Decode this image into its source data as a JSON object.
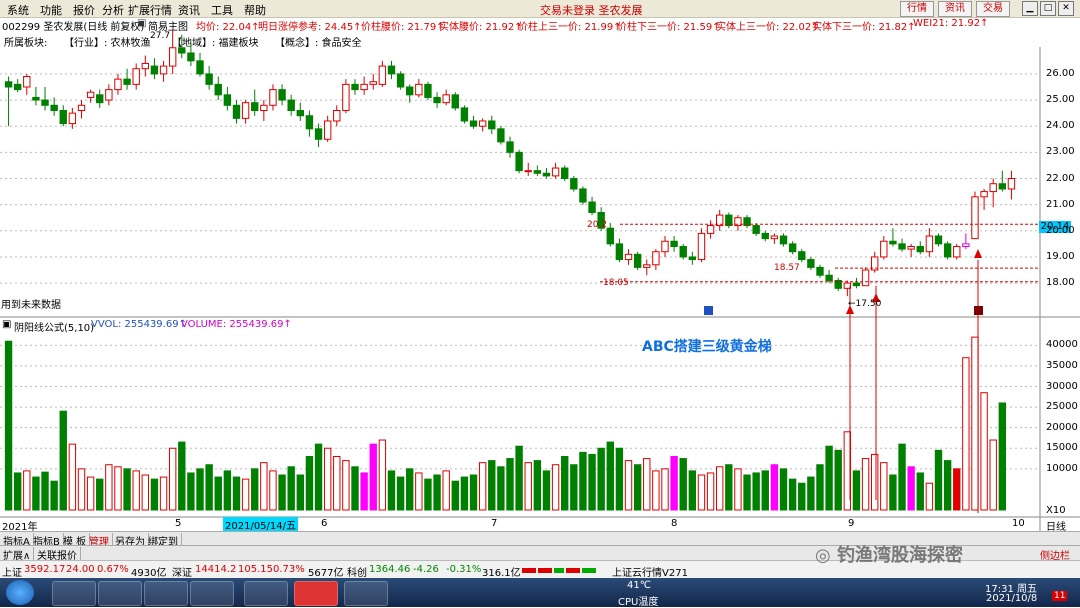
{
  "menu": [
    "系统",
    "功能",
    "报价",
    "分析",
    "扩展行情",
    "资讯",
    "工具",
    "帮助"
  ],
  "title_center": "交易未登录  圣农发展",
  "top_buttons": [
    "行情",
    "资讯",
    "交易"
  ],
  "info": {
    "stock": "002299 圣农发展(日线 前复权)",
    "icon_label": "简易主图",
    "items": [
      "均价: 22.04↑",
      "明日涨停参考: 24.45↑",
      "价柱腰价: 21.79↑",
      "实体腰价: 21.92↑",
      "价柱上三一价: 21.99↑",
      "价柱下三一价: 21.59↑",
      "实体上三一价: 22.02↑",
      "实体下三一价: 21.82↑",
      "WEI21: 21.92↑"
    ]
  },
  "sectors": {
    "label": "所属板块:",
    "industry": "【行业】: 农林牧渔",
    "region": "【地域】: 福建板块",
    "concept": "【概念】: 食品安全",
    "overlay_price": "27.7"
  },
  "price_axis": [
    "26.00",
    "25.00",
    "24.00",
    "23.00",
    "22.00",
    "21.00",
    "20.00",
    "19.00",
    "18.00"
  ],
  "price_current": "20.14",
  "annotations": {
    "left_level": "20.2",
    "mid_level": "18.57",
    "low_level": "18.05",
    "low_point": "17.50",
    "future_data": "用到未来数据",
    "headline": "ABC搭建三级黄金梯"
  },
  "indicator": {
    "name": "阴阳线公式(5,10)",
    "vol": "VVOL: 255439.69↑",
    "volume": "VOLUME: 255439.69↑"
  },
  "volume_axis": [
    "40000",
    "35000",
    "30000",
    "25000",
    "20000",
    "15000",
    "10000",
    "X10"
  ],
  "date_axis": {
    "year": "2021年",
    "months": [
      "5",
      "6",
      "7",
      "8",
      "9",
      "10"
    ],
    "cursor": "2021/05/14/五",
    "period": "日线"
  },
  "bottom_tabs": [
    "指标A",
    "指标B",
    "模 板",
    "管理",
    "另存为",
    "绑定到"
  ],
  "bottom_tabs2": [
    "扩展∧",
    "关联报价"
  ],
  "stats": {
    "sh": "上证",
    "sh_val": "3592.17",
    "sh_chg": "24.00",
    "sh_pct": "0.67%",
    "sh_amt": "4930亿",
    "sz": "深证",
    "sz_val": "14414.2",
    "sz_chg": "105.15",
    "sz_pct": "0.73%",
    "sz_amt": "5677亿",
    "kc": "科创",
    "kc_val": "1364.46",
    "kc_chg": "-4.26",
    "kc_pct": "-0.31%",
    "kc_amt": "316.1亿",
    "cloud": "上证云行情V271"
  },
  "taskbar": {
    "temp": "41℃",
    "cpu": "CPU温度",
    "time": "17:31 周五",
    "date": "2021/10/8",
    "notif": "11"
  },
  "watermark": "钓渔湾股海探密",
  "side_label": "侧边栏",
  "chart_data": {
    "type": "candlestick",
    "y_range": [
      17.2,
      26.8
    ],
    "volume_range": [
      0,
      43000
    ],
    "candles": [
      [
        25.7,
        25.9,
        24.0,
        25.5
      ],
      [
        25.6,
        25.8,
        25.3,
        25.4
      ],
      [
        25.5,
        26.0,
        25.2,
        25.9
      ],
      [
        25.1,
        25.5,
        24.8,
        25.0
      ],
      [
        25.0,
        25.5,
        24.6,
        24.8
      ],
      [
        24.8,
        25.1,
        24.4,
        24.6
      ],
      [
        24.6,
        24.8,
        24.0,
        24.1
      ],
      [
        24.1,
        24.7,
        23.9,
        24.5
      ],
      [
        24.6,
        25.0,
        24.3,
        24.8
      ],
      [
        25.1,
        25.4,
        24.9,
        25.3
      ],
      [
        25.2,
        25.4,
        24.7,
        24.9
      ],
      [
        25.0,
        25.6,
        24.8,
        25.4
      ],
      [
        25.4,
        26.0,
        25.2,
        25.8
      ],
      [
        25.8,
        26.2,
        25.4,
        25.6
      ],
      [
        25.6,
        26.4,
        25.4,
        26.2
      ],
      [
        26.2,
        26.7,
        25.9,
        26.4
      ],
      [
        26.3,
        26.6,
        25.8,
        26.0
      ],
      [
        26.0,
        26.5,
        25.7,
        26.3
      ],
      [
        26.3,
        27.7,
        26.0,
        27.0
      ],
      [
        27.0,
        27.5,
        26.6,
        26.8
      ],
      [
        26.8,
        27.2,
        26.3,
        26.5
      ],
      [
        26.5,
        26.8,
        25.9,
        26.0
      ],
      [
        26.0,
        26.3,
        25.4,
        25.6
      ],
      [
        25.6,
        25.9,
        25.0,
        25.2
      ],
      [
        25.2,
        25.5,
        24.6,
        24.8
      ],
      [
        24.8,
        25.0,
        24.1,
        24.3
      ],
      [
        24.3,
        25.0,
        24.1,
        24.9
      ],
      [
        24.9,
        25.4,
        24.4,
        24.6
      ],
      [
        24.6,
        25.0,
        24.2,
        24.8
      ],
      [
        24.8,
        25.6,
        24.6,
        25.4
      ],
      [
        25.4,
        25.6,
        24.8,
        25.0
      ],
      [
        25.0,
        25.2,
        24.4,
        24.6
      ],
      [
        24.6,
        24.9,
        24.2,
        24.4
      ],
      [
        24.4,
        24.6,
        23.6,
        23.9
      ],
      [
        23.9,
        24.1,
        23.2,
        23.5
      ],
      [
        23.5,
        24.4,
        23.4,
        24.2
      ],
      [
        24.2,
        24.8,
        24.0,
        24.6
      ],
      [
        24.6,
        25.8,
        24.5,
        25.6
      ],
      [
        25.6,
        25.8,
        25.2,
        25.4
      ],
      [
        25.4,
        25.9,
        25.2,
        25.6
      ],
      [
        25.6,
        26.0,
        25.4,
        25.7
      ],
      [
        25.6,
        26.5,
        25.5,
        26.3
      ],
      [
        26.3,
        26.5,
        25.8,
        26.0
      ],
      [
        26.0,
        26.1,
        25.4,
        25.5
      ],
      [
        25.5,
        25.6,
        24.9,
        25.2
      ],
      [
        25.2,
        25.8,
        25.1,
        25.6
      ],
      [
        25.6,
        25.7,
        25.0,
        25.1
      ],
      [
        25.1,
        25.3,
        24.7,
        24.9
      ],
      [
        24.9,
        25.4,
        24.8,
        25.2
      ],
      [
        25.2,
        25.3,
        24.6,
        24.7
      ],
      [
        24.7,
        24.8,
        24.1,
        24.2
      ],
      [
        24.2,
        24.4,
        23.9,
        24.0
      ],
      [
        24.0,
        24.3,
        23.8,
        24.2
      ],
      [
        24.2,
        24.4,
        23.7,
        23.9
      ],
      [
        23.9,
        24.0,
        23.3,
        23.4
      ],
      [
        23.4,
        23.6,
        22.8,
        23.0
      ],
      [
        23.0,
        23.1,
        22.2,
        22.3
      ],
      [
        22.3,
        22.6,
        22.1,
        22.3
      ],
      [
        22.3,
        22.5,
        22.1,
        22.2
      ],
      [
        22.2,
        22.4,
        22.0,
        22.1
      ],
      [
        22.1,
        22.6,
        22.0,
        22.4
      ],
      [
        22.4,
        22.5,
        21.9,
        22.0
      ],
      [
        22.0,
        22.1,
        21.5,
        21.6
      ],
      [
        21.6,
        21.7,
        21.0,
        21.1
      ],
      [
        21.1,
        21.3,
        20.6,
        20.7
      ],
      [
        20.7,
        20.9,
        20.0,
        20.1
      ],
      [
        20.1,
        20.3,
        19.4,
        19.5
      ],
      [
        19.5,
        19.7,
        18.8,
        18.9
      ],
      [
        18.9,
        19.3,
        18.7,
        19.1
      ],
      [
        19.1,
        19.2,
        18.5,
        18.6
      ],
      [
        18.6,
        18.9,
        18.3,
        18.7
      ],
      [
        18.7,
        19.3,
        18.5,
        19.2
      ],
      [
        19.2,
        19.8,
        19.0,
        19.6
      ],
      [
        19.6,
        19.8,
        19.2,
        19.4
      ],
      [
        19.4,
        19.5,
        18.9,
        19.0
      ],
      [
        19.0,
        19.2,
        18.7,
        18.9
      ],
      [
        18.9,
        20.1,
        18.8,
        19.9
      ],
      [
        19.9,
        20.4,
        19.7,
        20.2
      ],
      [
        20.2,
        20.8,
        20.0,
        20.6
      ],
      [
        20.6,
        20.7,
        20.1,
        20.2
      ],
      [
        20.2,
        20.6,
        20.0,
        20.5
      ],
      [
        20.5,
        20.6,
        20.1,
        20.2
      ],
      [
        20.2,
        20.3,
        19.8,
        19.9
      ],
      [
        19.9,
        20.0,
        19.6,
        19.7
      ],
      [
        19.7,
        19.9,
        19.5,
        19.8
      ],
      [
        19.8,
        19.9,
        19.4,
        19.5
      ],
      [
        19.5,
        19.6,
        19.1,
        19.2
      ],
      [
        19.2,
        19.3,
        18.8,
        18.9
      ],
      [
        18.9,
        19.0,
        18.5,
        18.6
      ],
      [
        18.6,
        18.7,
        18.2,
        18.3
      ],
      [
        18.3,
        18.5,
        18.0,
        18.1
      ],
      [
        18.1,
        18.2,
        17.7,
        17.8
      ],
      [
        17.8,
        18.1,
        17.5,
        18.0
      ],
      [
        18.0,
        18.2,
        17.8,
        17.9
      ],
      [
        17.9,
        18.6,
        17.9,
        18.5
      ],
      [
        18.5,
        19.2,
        18.4,
        19.0
      ],
      [
        19.0,
        19.8,
        18.9,
        19.6
      ],
      [
        19.6,
        20.1,
        19.4,
        19.5
      ],
      [
        19.5,
        19.7,
        19.2,
        19.3
      ],
      [
        19.3,
        19.5,
        19.0,
        19.4
      ],
      [
        19.4,
        19.6,
        19.1,
        19.2
      ],
      [
        19.2,
        20.1,
        19.0,
        19.8
      ],
      [
        19.8,
        19.9,
        19.4,
        19.5
      ],
      [
        19.5,
        19.6,
        18.9,
        19.0
      ],
      [
        19.0,
        19.5,
        18.9,
        19.4
      ],
      [
        19.4,
        19.9,
        19.3,
        19.5
      ],
      [
        19.7,
        21.5,
        19.7,
        21.3
      ],
      [
        21.3,
        21.6,
        20.8,
        21.5
      ],
      [
        21.5,
        22.0,
        20.9,
        21.8
      ],
      [
        21.8,
        22.3,
        21.5,
        21.6
      ],
      [
        21.6,
        22.3,
        21.2,
        22.0
      ]
    ],
    "volumes": [
      41000,
      9000,
      9500,
      8000,
      9200,
      7000,
      24000,
      16000,
      10000,
      8000,
      7500,
      11000,
      10500,
      10000,
      9500,
      8500,
      7500,
      8000,
      15000,
      16500,
      9000,
      10000,
      11000,
      8000,
      9500,
      8000,
      7500,
      10000,
      11500,
      9500,
      8500,
      10500,
      8500,
      13000,
      16000,
      15000,
      13000,
      12000,
      10500,
      9000,
      16000,
      17000,
      9500,
      8000,
      10000,
      9000,
      7500,
      8500,
      9500,
      7000,
      8000,
      8500,
      11500,
      12000,
      10500,
      12500,
      15500,
      11500,
      12000,
      9500,
      11000,
      13000,
      11000,
      14000,
      13500,
      15000,
      16500,
      15000,
      12000,
      11000,
      12500,
      9500,
      10000,
      13000,
      12500,
      9500,
      8500,
      9000,
      10500,
      11000,
      10000,
      8500,
      9000,
      9500,
      11000,
      10000,
      7500,
      6500,
      8000,
      11000,
      15500,
      14500,
      19000,
      9500,
      12500,
      13500,
      11500,
      8500,
      16000,
      10500,
      9000,
      6500,
      14500,
      12000,
      10000,
      37000,
      42000,
      28500,
      17000,
      26000
    ],
    "magenta_bars": [
      39,
      40,
      73,
      84,
      99
    ],
    "highlight_bar": 105
  }
}
